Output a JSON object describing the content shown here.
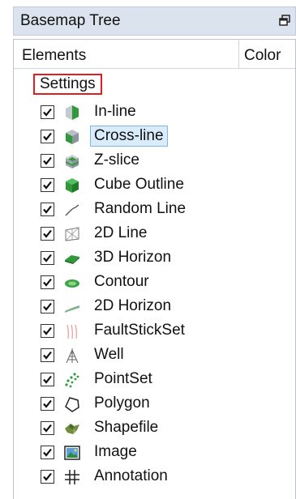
{
  "panel": {
    "title": "Basemap Tree",
    "float_icon": "float-window-icon"
  },
  "tree": {
    "columns": [
      "Elements",
      "Color"
    ],
    "root_label": "Settings",
    "items": [
      {
        "label": "In-line",
        "checked": true,
        "icon": "inline-cube-icon",
        "selected": false
      },
      {
        "label": "Cross-line",
        "checked": true,
        "icon": "crossline-cube-icon",
        "selected": true
      },
      {
        "label": "Z-slice",
        "checked": true,
        "icon": "zslice-cube-icon",
        "selected": false
      },
      {
        "label": "Cube Outline",
        "checked": true,
        "icon": "cube-outline-icon",
        "selected": false
      },
      {
        "label": "Random Line",
        "checked": true,
        "icon": "random-line-icon",
        "selected": false
      },
      {
        "label": "2D Line",
        "checked": true,
        "icon": "2d-line-icon",
        "selected": false
      },
      {
        "label": "3D Horizon",
        "checked": true,
        "icon": "3d-horizon-icon",
        "selected": false
      },
      {
        "label": "Contour",
        "checked": true,
        "icon": "contour-icon",
        "selected": false
      },
      {
        "label": "2D Horizon",
        "checked": true,
        "icon": "2d-horizon-icon",
        "selected": false
      },
      {
        "label": "FaultStickSet",
        "checked": true,
        "icon": "faultstickset-icon",
        "selected": false
      },
      {
        "label": "Well",
        "checked": true,
        "icon": "well-icon",
        "selected": false
      },
      {
        "label": "PointSet",
        "checked": true,
        "icon": "pointset-icon",
        "selected": false
      },
      {
        "label": "Polygon",
        "checked": true,
        "icon": "polygon-icon",
        "selected": false
      },
      {
        "label": "Shapefile",
        "checked": true,
        "icon": "shapefile-icon",
        "selected": false
      },
      {
        "label": "Image",
        "checked": true,
        "icon": "image-icon",
        "selected": false
      },
      {
        "label": "Annotation",
        "checked": true,
        "icon": "annotation-icon",
        "selected": false
      }
    ]
  },
  "colors": {
    "titlebar_bg": "#dbe4ee",
    "selection_bg": "#d9ecfb",
    "selection_border": "#7fb6e4",
    "settings_outline": "#e02020",
    "icon_green": "#2e9a3a"
  }
}
